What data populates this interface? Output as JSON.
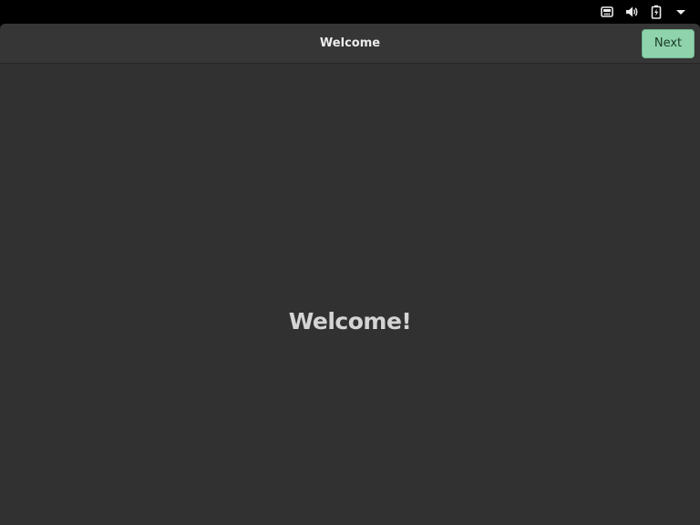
{
  "system_tray": {
    "icons": [
      "network-icon",
      "volume-icon",
      "battery-icon",
      "menu-arrow-icon"
    ]
  },
  "window": {
    "title": "Welcome",
    "next_label": "Next"
  },
  "content": {
    "heading": "Welcome!"
  },
  "colors": {
    "accent": "#8fd3ac",
    "background": "#313131",
    "headerbar": "#363636"
  }
}
